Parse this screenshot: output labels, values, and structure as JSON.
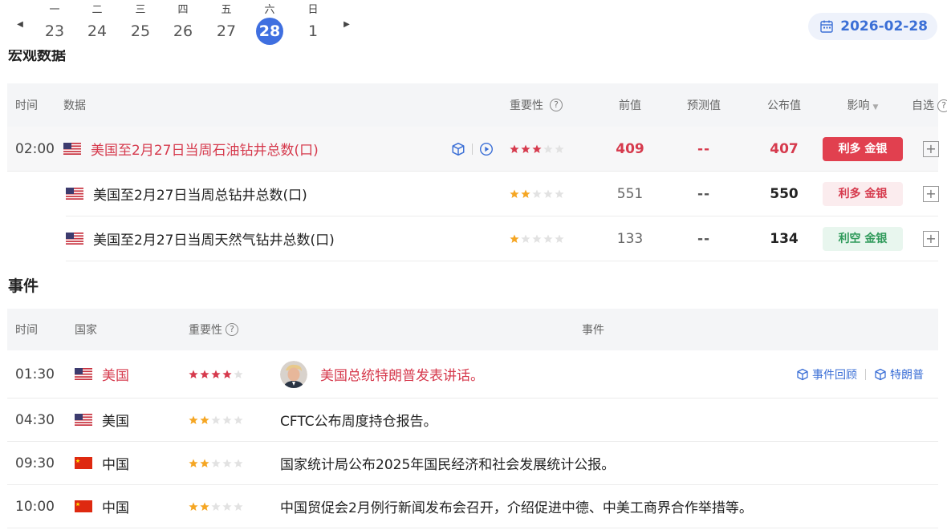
{
  "calendar": {
    "days": [
      {
        "weekday": "一",
        "day": "23"
      },
      {
        "weekday": "二",
        "day": "24"
      },
      {
        "weekday": "三",
        "day": "25"
      },
      {
        "weekday": "四",
        "day": "26"
      },
      {
        "weekday": "五",
        "day": "27"
      },
      {
        "weekday": "六",
        "day": "28"
      },
      {
        "weekday": "日",
        "day": "1"
      }
    ],
    "selected_date": "2026-02-28"
  },
  "data_section": {
    "title": "宏观数据",
    "headers": {
      "time": "时间",
      "data": "数据",
      "importance": "重要性",
      "previous": "前值",
      "forecast": "预测值",
      "published": "公布值",
      "effect": "影响",
      "favorite": "自选"
    },
    "rows": [
      {
        "time": "02:00",
        "country": "美国",
        "name": "美国至2月27日当周石油钻井总数(口)",
        "stars": 3,
        "previous": "409",
        "forecast": "--",
        "published": "407",
        "effect": "利多 金银"
      },
      {
        "time": "",
        "country": "美国",
        "name": "美国至2月27日当周总钻井总数(口)",
        "stars": 2,
        "previous": "551",
        "forecast": "--",
        "published": "550",
        "effect": "利多 金银"
      },
      {
        "time": "",
        "country": "美国",
        "name": "美国至2月27日当周天然气钻井总数(口)",
        "stars": 1,
        "previous": "133",
        "forecast": "--",
        "published": "134",
        "effect": "利空 金银"
      }
    ],
    "plus": "+"
  },
  "event_section": {
    "title": "事件",
    "headers": {
      "time": "时间",
      "country": "国家",
      "importance": "重要性",
      "event": "事件"
    },
    "rows": [
      {
        "time": "01:30",
        "country": "美国",
        "stars": 4,
        "event": "美国总统特朗普发表讲话。"
      },
      {
        "time": "04:30",
        "country": "美国",
        "stars": 2,
        "event": "CFTC公布周度持仓报告。"
      },
      {
        "time": "09:30",
        "country": "中国",
        "stars": 2,
        "event": "国家统计局公布2025年国民经济和社会发展统计公报。"
      },
      {
        "time": "10:00",
        "country": "中国",
        "stars": 2,
        "event": "中国贸促会2月例行新闻发布会召开，介绍促进中德、中美工商界合作举措等。"
      }
    ],
    "actions": {
      "review": "事件回顾",
      "person": "特朗普"
    }
  },
  "colors": {
    "accent": "#3f6fe0",
    "bullish_solid": "#e1404f",
    "bearish_green": "#2f9a5a",
    "star_gold": "#f5a623",
    "star_red": "#d63a4d"
  }
}
